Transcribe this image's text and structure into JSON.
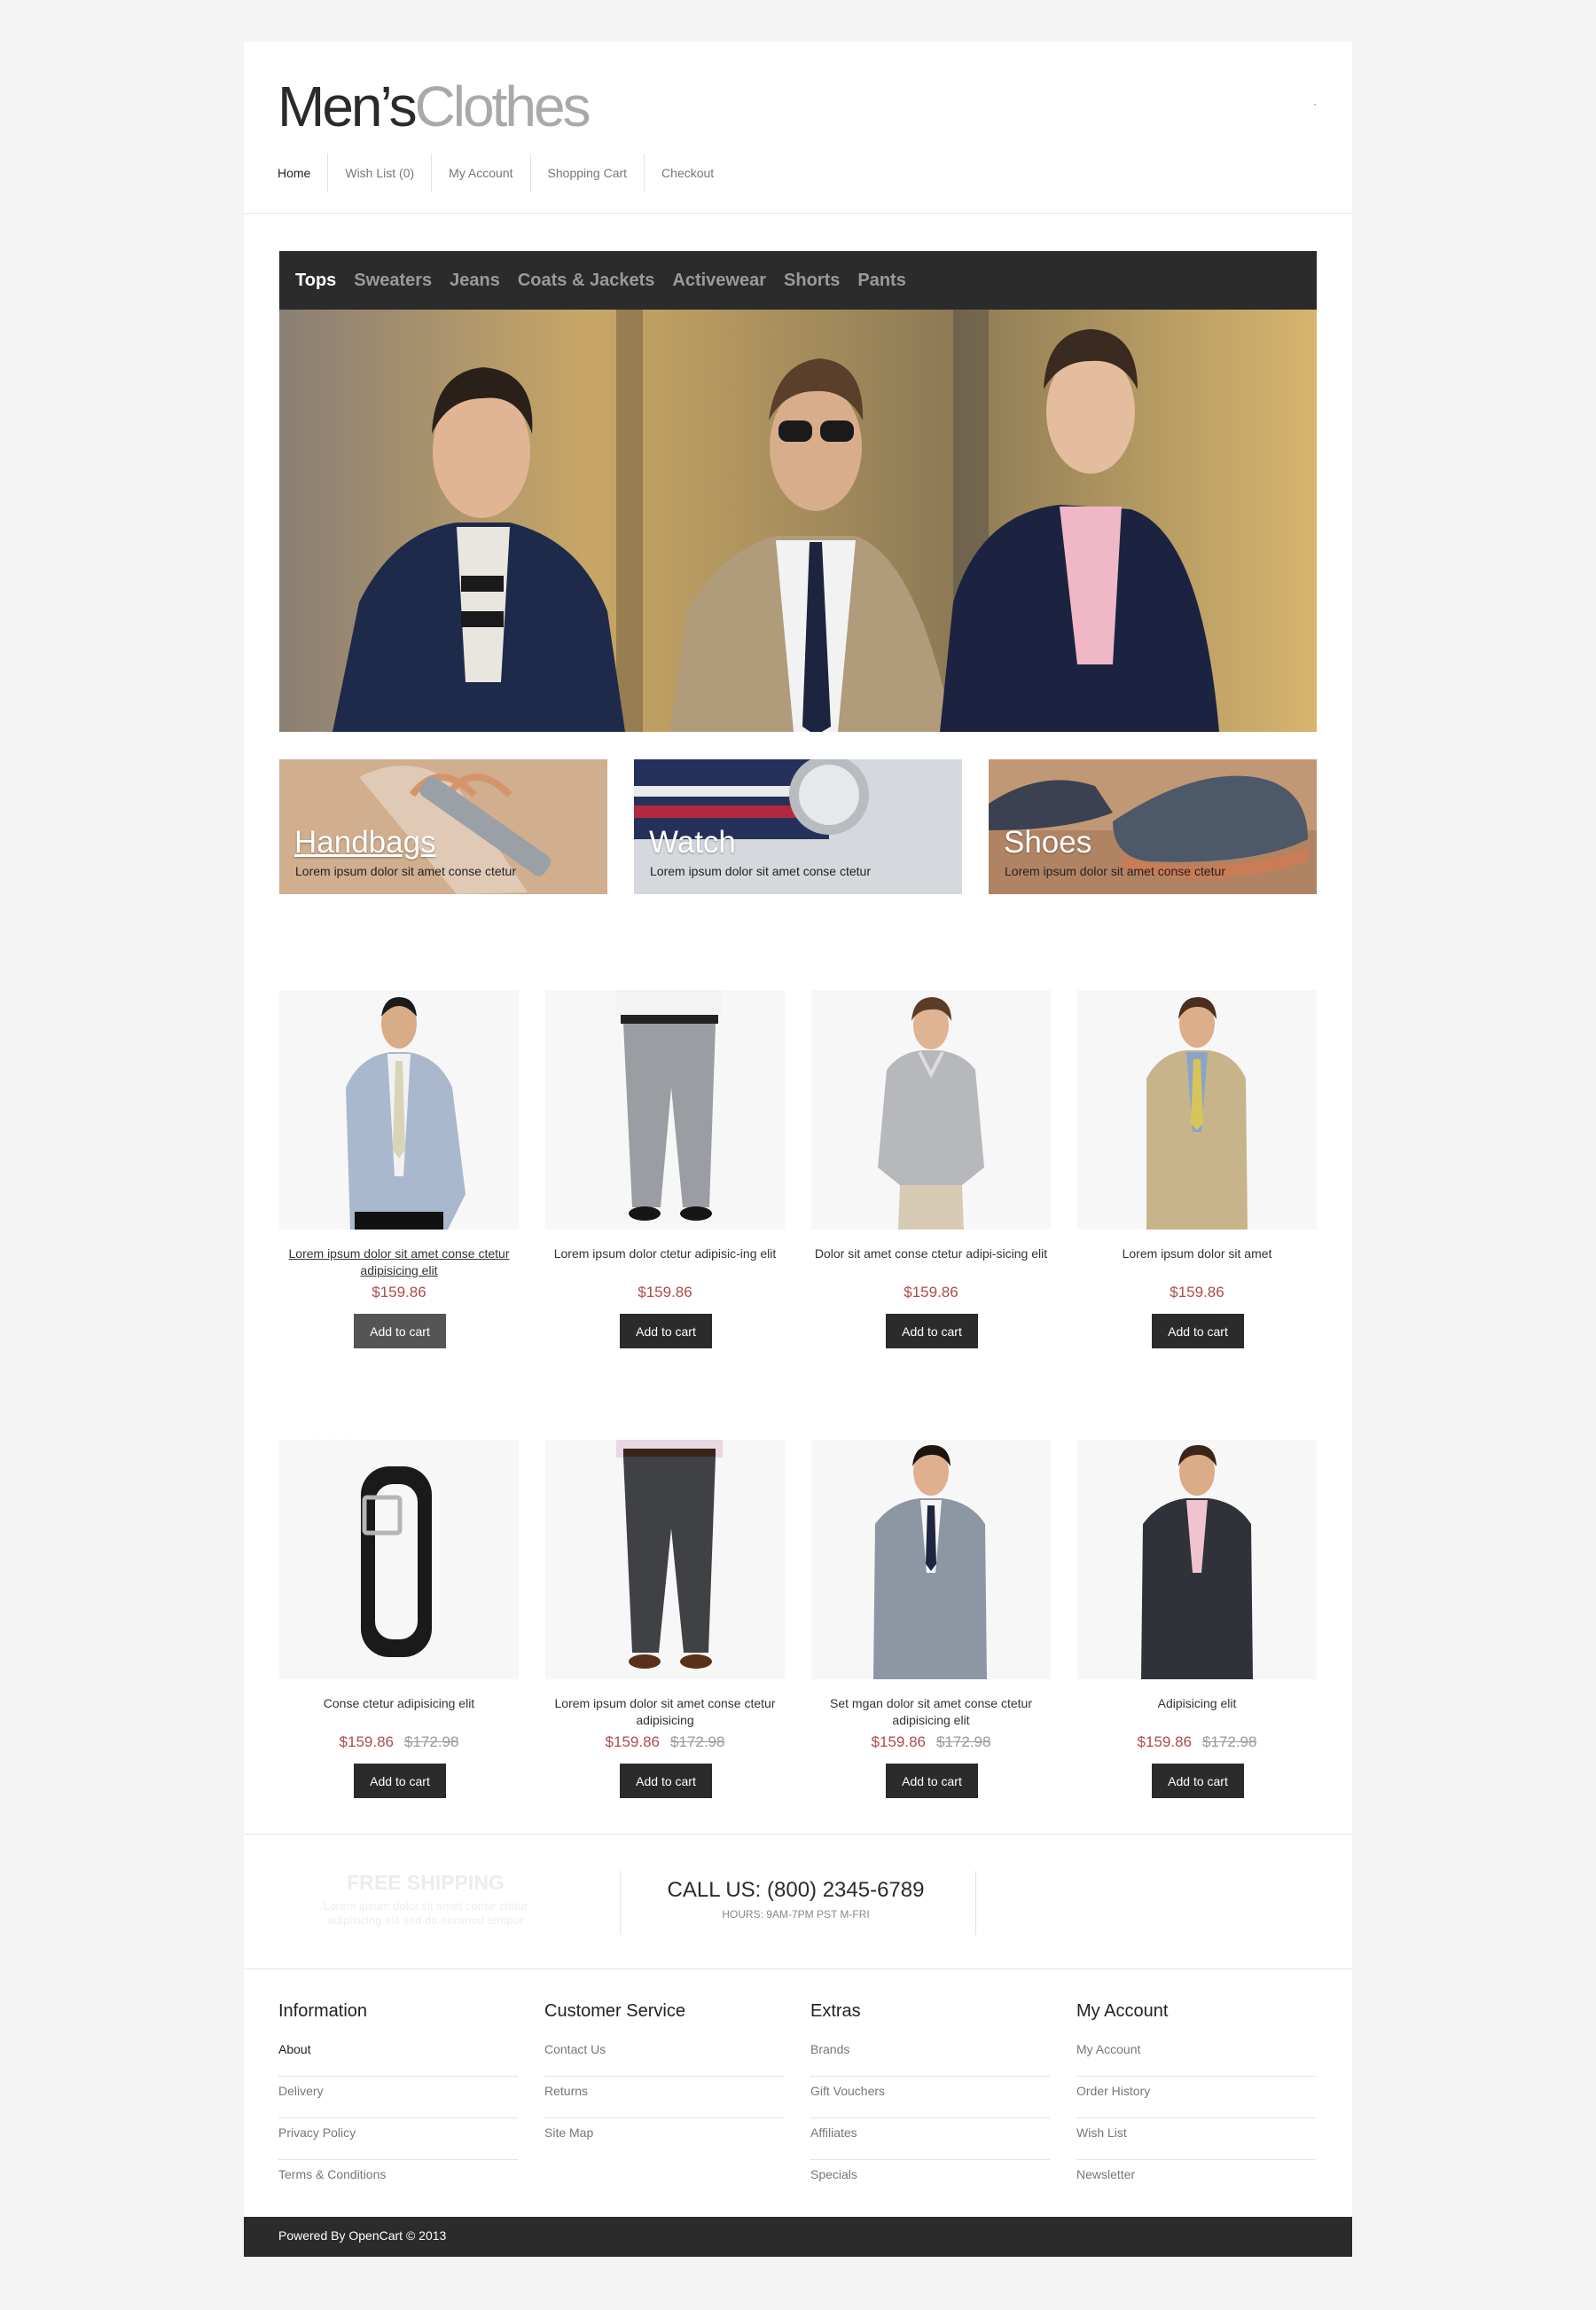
{
  "brand": {
    "name_part1": "Men’s",
    "name_part2": "Clothes"
  },
  "top_nav": [
    "Home",
    "Wish List (0)",
    "My Account",
    "Shopping Cart",
    "Checkout"
  ],
  "categories": [
    "Tops",
    "Sweaters",
    "Jeans",
    "Coats & Jackets",
    "Activewear",
    "Shorts",
    "Pants"
  ],
  "banners": [
    {
      "title": "Handbags",
      "subtitle": "Lorem ipsum dolor sit amet conse ctetur"
    },
    {
      "title": "Watch",
      "subtitle": "Lorem ipsum dolor sit amet conse ctetur"
    },
    {
      "title": "Shoes",
      "subtitle": "Lorem ipsum dolor sit amet conse ctetur"
    }
  ],
  "button_label": "Add to cart",
  "products": [
    {
      "name": "Lorem ipsum dolor sit amet conse ctetur adipisicing elit",
      "price": "$159.86",
      "old_price": ""
    },
    {
      "name": "Lorem ipsum dolor ctetur adipisic-ing elit",
      "price": "$159.86",
      "old_price": ""
    },
    {
      "name": "Dolor sit amet conse ctetur adipi-sicing elit",
      "price": "$159.86",
      "old_price": ""
    },
    {
      "name": "Lorem ipsum dolor sit amet",
      "price": "$159.86",
      "old_price": ""
    },
    {
      "name": "Conse ctetur adipisicing elit",
      "price": "$159.86",
      "old_price": "$172.98"
    },
    {
      "name": "Lorem ipsum dolor sit amet conse ctetur adipisicing",
      "price": "$159.86",
      "old_price": "$172.98"
    },
    {
      "name": "Set mgan dolor sit amet conse ctetur adipisicing elit",
      "price": "$159.86",
      "old_price": "$172.98"
    },
    {
      "name": "Adipisicing elit",
      "price": "$159.86",
      "old_price": "$172.98"
    }
  ],
  "shipping": {
    "title": "FREE SHIPPING",
    "text": "Lorem ipsum dolor sit amet conse ctetur adipisicing elit sed do eiusmod tempor"
  },
  "contact": {
    "call": "CALL US: (800) 2345-6789",
    "hours": "HOURS: 9AM-7PM PST M-FRI"
  },
  "footer": {
    "columns": [
      {
        "title": "Information",
        "links": [
          "About",
          "Delivery",
          "Privacy Policy",
          "Terms & Conditions"
        ]
      },
      {
        "title": "Customer Service",
        "links": [
          "Contact Us",
          "Returns",
          "Site Map"
        ]
      },
      {
        "title": "Extras",
        "links": [
          "Brands",
          "Gift Vouchers",
          "Affiliates",
          "Specials"
        ]
      },
      {
        "title": "My Account",
        "links": [
          "My Account",
          "Order History",
          "Wish List",
          "Newsletter"
        ]
      }
    ],
    "powered": "Powered By OpenCart © 2013"
  },
  "colors": {
    "dark_bar": "#2b2b2b",
    "price": "#b04a4a",
    "page_bg": "#f4f4f4"
  }
}
